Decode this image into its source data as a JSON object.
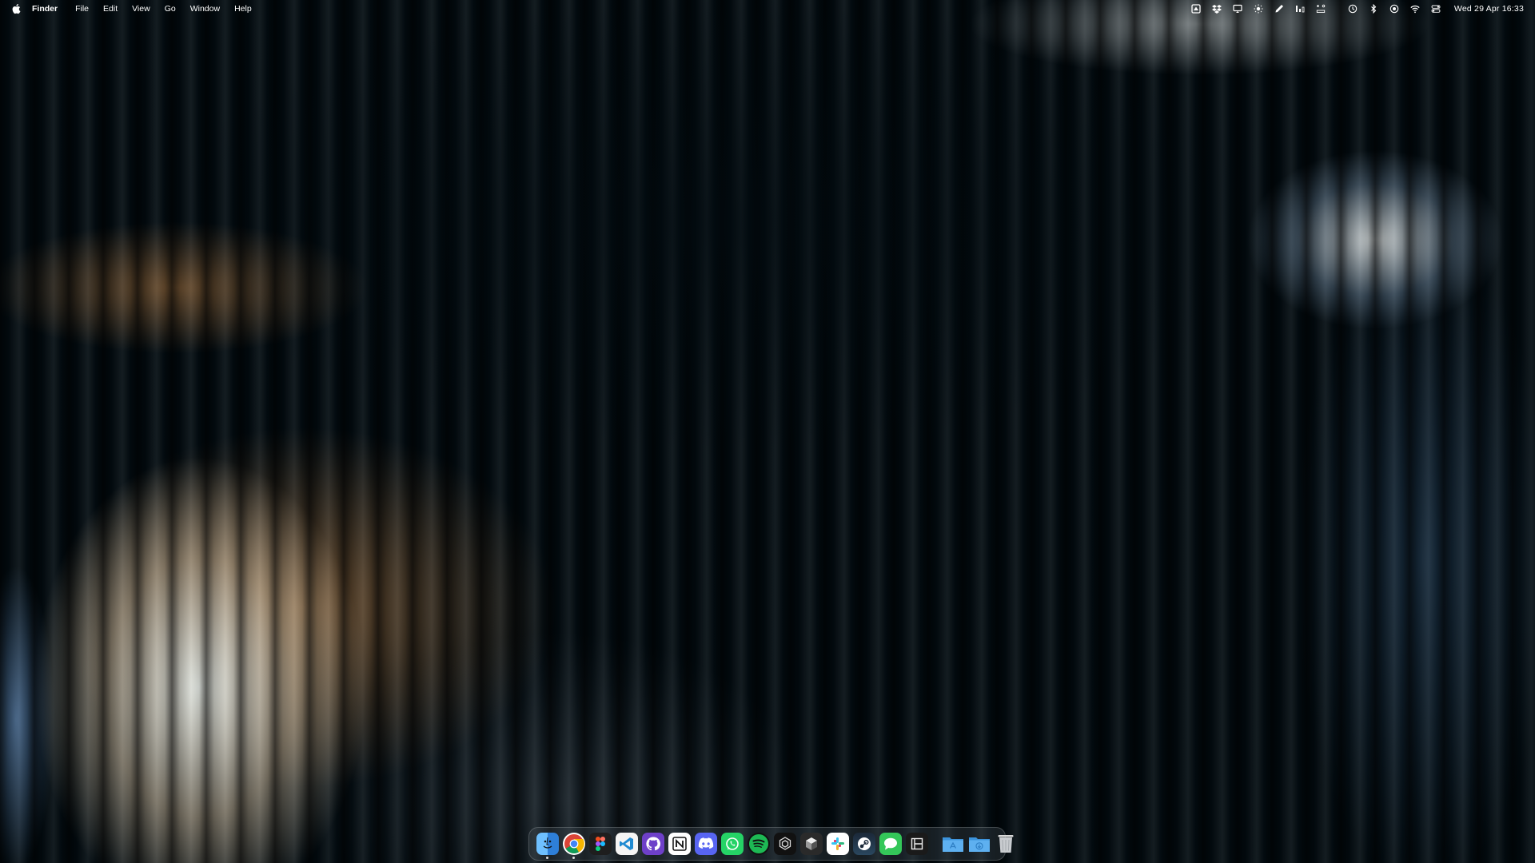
{
  "menubar": {
    "apple_icon": "apple-icon",
    "app_name": "Finder",
    "menus": [
      "File",
      "Edit",
      "View",
      "Go",
      "Window",
      "Help"
    ],
    "status_icons": [
      "drive-icon",
      "dropbox-icon",
      "display-icon",
      "brightness-icon",
      "pen-icon",
      "battery-stats-icon",
      "app-switch-icon",
      "time-machine-icon",
      "bluetooth-icon",
      "screen-record-icon",
      "wifi-icon",
      "control-center-icon"
    ],
    "datetime": "Wed 29 Apr  16:33"
  },
  "dock": {
    "apps": [
      {
        "name": "Finder",
        "icon": "finder-icon",
        "color": "#3b8fe6",
        "running": true
      },
      {
        "name": "Google Chrome",
        "icon": "chrome-icon",
        "color": "#ffffff",
        "running": true
      },
      {
        "name": "Figma",
        "icon": "figma-icon",
        "color": "#1e1e1e",
        "running": false
      },
      {
        "name": "Visual Studio Code",
        "icon": "vscode-icon",
        "color": "#ffffff",
        "running": false
      },
      {
        "name": "GitHub Desktop",
        "icon": "github-icon",
        "color": "#6e40c9",
        "running": false
      },
      {
        "name": "Notion",
        "icon": "notion-icon",
        "color": "#ffffff",
        "running": false
      },
      {
        "name": "Discord",
        "icon": "discord-icon",
        "color": "#5865f2",
        "running": false
      },
      {
        "name": "WhatsApp",
        "icon": "whatsapp-icon",
        "color": "#25d366",
        "running": false
      },
      {
        "name": "Spotify",
        "icon": "spotify-icon",
        "color": "#1db954",
        "running": false
      },
      {
        "name": "ChatGPT",
        "icon": "chatgpt-icon",
        "color": "#111111",
        "running": false
      },
      {
        "name": "Cube app",
        "icon": "cube-icon",
        "color": "#2a2a2a",
        "running": false
      },
      {
        "name": "Slack",
        "icon": "slack-icon",
        "color": "#ffffff",
        "running": false
      },
      {
        "name": "Steam",
        "icon": "steam-icon",
        "color": "#1b2838",
        "running": false
      },
      {
        "name": "Messages",
        "icon": "messages-icon",
        "color": "#34c759",
        "running": false
      },
      {
        "name": "Window app",
        "icon": "window-app-icon",
        "color": "#1a1a1a",
        "running": false
      }
    ],
    "folders": [
      {
        "name": "Applications",
        "icon": "applications-folder-icon",
        "color": "#4aa3e8"
      },
      {
        "name": "Downloads",
        "icon": "downloads-folder-icon",
        "color": "#4aa3e8"
      }
    ],
    "trash": {
      "name": "Trash",
      "icon": "trash-icon"
    }
  }
}
